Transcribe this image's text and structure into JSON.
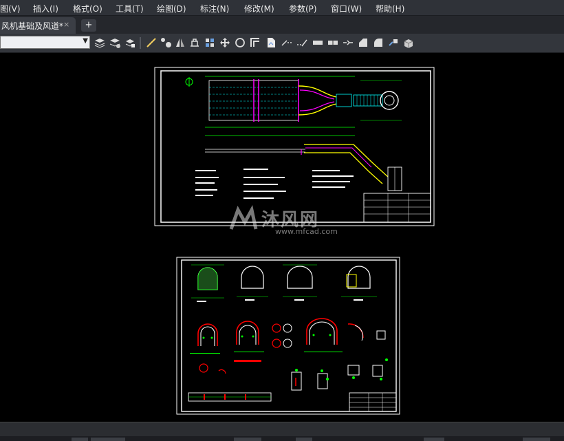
{
  "menubar": {
    "items": [
      {
        "label": "图(V)"
      },
      {
        "label": "插入(I)"
      },
      {
        "label": "格式(O)"
      },
      {
        "label": "工具(T)"
      },
      {
        "label": "绘图(D)"
      },
      {
        "label": "标注(N)"
      },
      {
        "label": "修改(M)"
      },
      {
        "label": "参数(P)"
      },
      {
        "label": "窗口(W)"
      },
      {
        "label": "帮助(H)"
      }
    ]
  },
  "tabs": {
    "active_document": "风机基础及风道*",
    "close_symbol": "×",
    "new_tab_symbol": "+"
  },
  "toolbar": {
    "layer_combo_value": "",
    "icons": [
      "layer-properties-icon",
      "layer-state-icon",
      "layer-match-icon",
      "line-icon",
      "polyline-icon",
      "mirror-icon",
      "stretch-icon",
      "array-icon",
      "move-icon",
      "circle-icon",
      "offset-icon",
      "hatch-icon",
      "trim-icon",
      "extend-icon",
      "break-icon",
      "join-icon",
      "measure-icon",
      "chamfer-icon",
      "fillet-icon",
      "explode-icon",
      "block-icon"
    ]
  },
  "watermark": {
    "text": "沐风网",
    "url": "www.mfcad.com"
  },
  "colors": {
    "background": "#000000",
    "menubar": "#2f3238",
    "toolbar": "#33363c",
    "drawing_frame": "#ffffff",
    "drawing_green": "#00ff00",
    "drawing_yellow": "#ffff00",
    "drawing_magenta": "#ff00ff",
    "drawing_red": "#ff0000",
    "drawing_cyan": "#00ffff"
  }
}
